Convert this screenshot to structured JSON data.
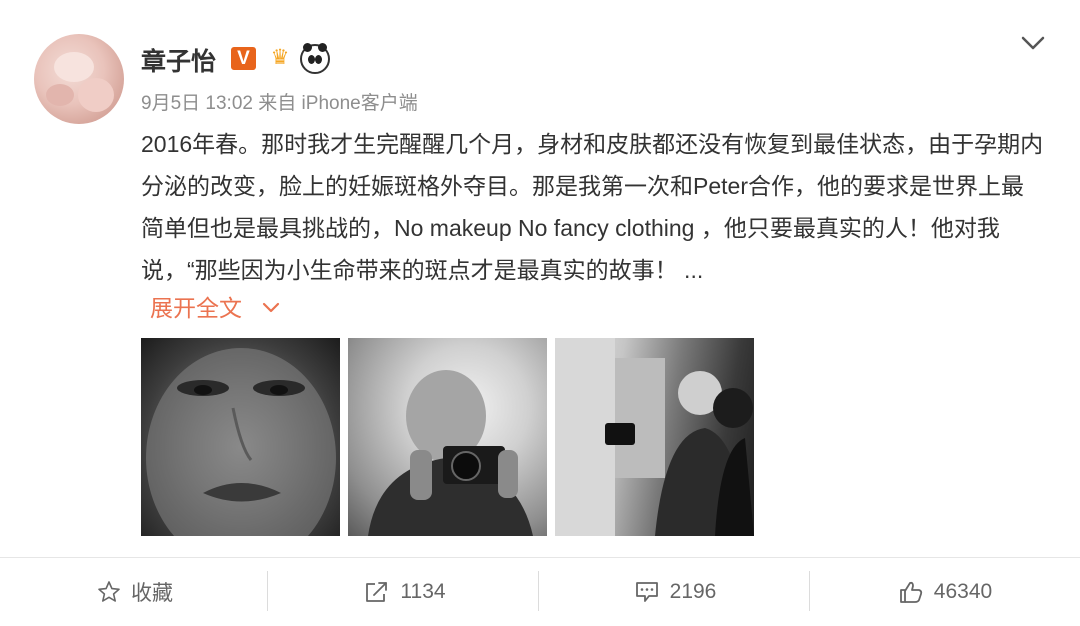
{
  "user": {
    "name": "章子怡",
    "verified_badge": "V"
  },
  "post": {
    "date": "9月5日 13:02",
    "source_prefix": "来自",
    "source": "iPhone客户端",
    "text": "2016年春。那时我才生完醒醒几个月，身材和皮肤都还没有恢复到最佳状态，由于孕期内分泌的改变，脸上的妊娠斑格外夺目。那是我第一次和Peter合作，他的要求是世界上最简单但也是最具挑战的，No makeup No fancy clothing ，他只要最真实的人！他对我说，“那些因为小生命带来的斑点才是最真实的故事！ ...",
    "expand_label": "展开全文"
  },
  "actions": {
    "favorite_label": "收藏",
    "repost_count": "1134",
    "comment_count": "2196",
    "like_count": "46340"
  },
  "icons": {
    "badges": [
      "verified-v-icon",
      "crown-icon",
      "panda-icon"
    ],
    "menu": "chevron-down-icon",
    "actions": [
      "star-icon",
      "share-icon",
      "comment-icon",
      "thumbs-up-icon"
    ]
  },
  "colors": {
    "accent": "#eb7350",
    "verified": "#e8641b",
    "text": "#333333",
    "meta": "#8e8e8e"
  }
}
